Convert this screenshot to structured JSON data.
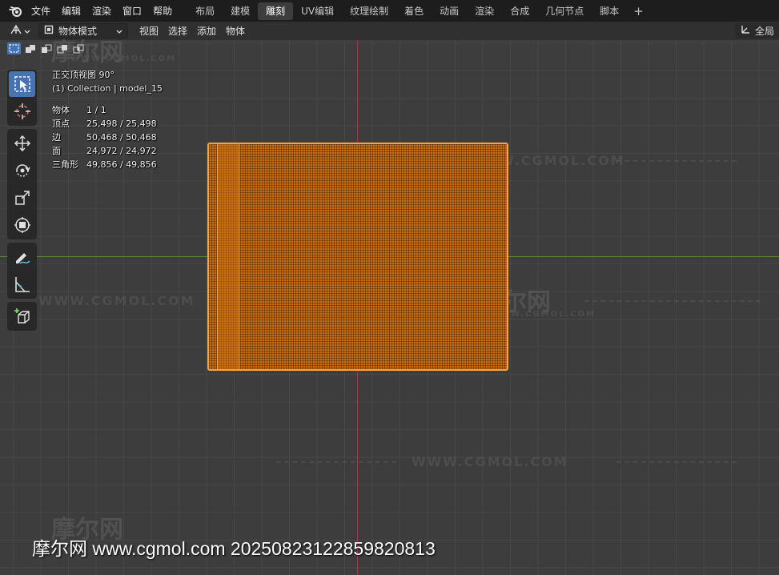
{
  "app": {
    "logo_icon": "blender-logo-icon",
    "menu": [
      "文件",
      "编辑",
      "渲染",
      "窗口",
      "帮助"
    ],
    "workspace_tabs": [
      {
        "label": "布局",
        "active": false
      },
      {
        "label": "建模",
        "active": false
      },
      {
        "label": "雕刻",
        "active": true
      },
      {
        "label": "UV编辑",
        "active": false
      },
      {
        "label": "纹理绘制",
        "active": false
      },
      {
        "label": "着色",
        "active": false
      },
      {
        "label": "动画",
        "active": false
      },
      {
        "label": "渲染",
        "active": false
      },
      {
        "label": "合成",
        "active": false
      },
      {
        "label": "几何节点",
        "active": false
      },
      {
        "label": "脚本",
        "active": false
      }
    ],
    "add_tab": "+"
  },
  "viewport_header": {
    "mode": "物体模式",
    "menus": [
      "视图",
      "选择",
      "添加",
      "物体"
    ],
    "right_label": "全局"
  },
  "overlay": {
    "view_name": "正交顶视图 90°",
    "collection": "(1) Collection | model_15",
    "stats": [
      {
        "label": "物体",
        "value": "1 / 1"
      },
      {
        "label": "顶点",
        "value": "25,498 / 25,498"
      },
      {
        "label": "边",
        "value": "50,468 / 50,468"
      },
      {
        "label": "面",
        "value": "24,972 / 24,972"
      },
      {
        "label": "三角形",
        "value": "49,856 / 49,856"
      }
    ]
  },
  "toolbar": {
    "tools": [
      "select-box-icon",
      "cursor-icon",
      "move-icon",
      "rotate-icon",
      "scale-icon",
      "transform-icon",
      "annotate-icon",
      "measure-icon",
      "add-cube-icon"
    ],
    "active": "select-box-icon"
  },
  "colors": {
    "selection_orange": "#f5a343",
    "axis_red": "#9a3a45",
    "axis_green": "#5f8a35",
    "active_blue": "#4772b3"
  },
  "watermark": {
    "brand": "摩尔网",
    "site": "WWW.CGMOL.COM",
    "site_small": "WWW.CGMOL.COM",
    "bottom_text": "摩尔网 www.cgmol.com 20250823122859820813"
  }
}
